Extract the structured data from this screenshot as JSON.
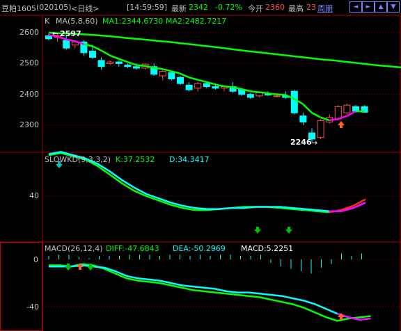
{
  "header": {
    "symbol": "豆粕1605",
    "code": "(020105)",
    "period": "<日线>",
    "time": "[14:59:59]",
    "last_label": "最新",
    "last_value": "2342",
    "change_pct": "-0.72%",
    "open_label": "今开",
    "open_value": "2360",
    "high_label": "最高",
    "high_value": "23",
    "cycle_label": "周期"
  },
  "nav_icons": [
    "arrow-left-icon",
    "arrow-right-icon",
    "arrow-up-icon",
    "arrow-down-icon"
  ],
  "colors": {
    "up": "#ff5050",
    "down": "#00ffff",
    "ma1": "#ffffff",
    "ma2": "#00ff00",
    "k": "#00ff00",
    "d": "#00ffff",
    "dea": "#ff00ff",
    "border": "#a00000"
  },
  "kline": {
    "title": "K",
    "ma_label": "MA(5,8,60)",
    "ma1_label": "MA1:2344.6730",
    "ma2_label": "MA2:2482.7217",
    "y_ticks": [
      "2600",
      "2500",
      "2400",
      "2300"
    ],
    "high_marker": "2597",
    "low_marker": "2246"
  },
  "kd": {
    "title": "SLOWKD(9,3,3,2)",
    "k_label": "K:37.2532",
    "d_label": "D:34.3417",
    "y_ticks": [
      "40"
    ]
  },
  "macd": {
    "title": "MACD(26,12,4)",
    "diff_label": "DIFF:-47.6843",
    "dea_label": "DEA:-50.2969",
    "macd_label": "MACD:5.2251",
    "y_ticks": [
      "0",
      "-40"
    ]
  },
  "chart_data": {
    "type": "candlestick",
    "candles": [
      {
        "o": 2590,
        "h": 2597,
        "l": 2575,
        "c": 2580
      },
      {
        "o": 2585,
        "h": 2596,
        "l": 2570,
        "c": 2592
      },
      {
        "o": 2575,
        "h": 2590,
        "l": 2545,
        "c": 2550
      },
      {
        "o": 2560,
        "h": 2575,
        "l": 2550,
        "c": 2570
      },
      {
        "o": 2570,
        "h": 2575,
        "l": 2525,
        "c": 2535
      },
      {
        "o": 2540,
        "h": 2560,
        "l": 2515,
        "c": 2520
      },
      {
        "o": 2510,
        "h": 2520,
        "l": 2480,
        "c": 2490
      },
      {
        "o": 2500,
        "h": 2510,
        "l": 2495,
        "c": 2505
      },
      {
        "o": 2505,
        "h": 2510,
        "l": 2490,
        "c": 2500
      },
      {
        "o": 2495,
        "h": 2500,
        "l": 2485,
        "c": 2490
      },
      {
        "o": 2490,
        "h": 2500,
        "l": 2480,
        "c": 2485
      },
      {
        "o": 2485,
        "h": 2500,
        "l": 2480,
        "c": 2498
      },
      {
        "o": 2490,
        "h": 2500,
        "l": 2460,
        "c": 2465
      },
      {
        "o": 2460,
        "h": 2480,
        "l": 2445,
        "c": 2475
      },
      {
        "o": 2470,
        "h": 2475,
        "l": 2445,
        "c": 2450
      },
      {
        "o": 2455,
        "h": 2460,
        "l": 2430,
        "c": 2435
      },
      {
        "o": 2430,
        "h": 2440,
        "l": 2410,
        "c": 2415
      },
      {
        "o": 2420,
        "h": 2440,
        "l": 2410,
        "c": 2435
      },
      {
        "o": 2435,
        "h": 2440,
        "l": 2420,
        "c": 2425
      },
      {
        "o": 2425,
        "h": 2435,
        "l": 2415,
        "c": 2420
      },
      {
        "o": 2420,
        "h": 2430,
        "l": 2410,
        "c": 2425
      },
      {
        "o": 2425,
        "h": 2440,
        "l": 2405,
        "c": 2410
      },
      {
        "o": 2415,
        "h": 2420,
        "l": 2395,
        "c": 2400
      },
      {
        "o": 2400,
        "h": 2405,
        "l": 2385,
        "c": 2390
      },
      {
        "o": 2395,
        "h": 2410,
        "l": 2390,
        "c": 2405
      },
      {
        "o": 2400,
        "h": 2410,
        "l": 2395,
        "c": 2398
      },
      {
        "o": 2395,
        "h": 2400,
        "l": 2390,
        "c": 2395
      },
      {
        "o": 2395,
        "h": 2410,
        "l": 2385,
        "c": 2390
      },
      {
        "o": 2410,
        "h": 2415,
        "l": 2335,
        "c": 2340
      },
      {
        "o": 2330,
        "h": 2340,
        "l": 2300,
        "c": 2310
      },
      {
        "o": 2275,
        "h": 2290,
        "l": 2246,
        "c": 2255
      },
      {
        "o": 2260,
        "h": 2320,
        "l": 2255,
        "c": 2315
      },
      {
        "o": 2310,
        "h": 2335,
        "l": 2305,
        "c": 2325
      },
      {
        "o": 2320,
        "h": 2365,
        "l": 2315,
        "c": 2360
      },
      {
        "o": 2340,
        "h": 2370,
        "l": 2335,
        "c": 2365
      },
      {
        "o": 2360,
        "h": 2365,
        "l": 2340,
        "c": 2345
      },
      {
        "o": 2360,
        "h": 2365,
        "l": 2340,
        "c": 2342
      }
    ],
    "ma1": [
      2592,
      2588,
      2578,
      2572,
      2563,
      2556,
      2542,
      2526,
      2515,
      2505,
      2495,
      2492,
      2486,
      2482,
      2475,
      2467,
      2455,
      2447,
      2440,
      2432,
      2426,
      2423,
      2417,
      2410,
      2407,
      2403,
      2400,
      2398,
      2385,
      2368,
      2340,
      2325,
      2316,
      2320,
      2330,
      2345,
      2345
    ],
    "ma2": [
      2600,
      2598,
      2597,
      2595,
      2593,
      2590,
      2587,
      2583,
      2580,
      2577,
      2573,
      2570,
      2566,
      2562,
      2558,
      2554,
      2550,
      2545,
      2541,
      2537,
      2533,
      2529,
      2525,
      2521,
      2517,
      2513,
      2510,
      2506,
      2502,
      2498,
      2494,
      2491,
      2488,
      2486,
      2484,
      2483,
      2482
    ],
    "kd_k": [
      78,
      80,
      77,
      74,
      68,
      60,
      52,
      45,
      40,
      36,
      32,
      29,
      27,
      27,
      28,
      29,
      30,
      30,
      30,
      29,
      28,
      27,
      26,
      25,
      27,
      31,
      37
    ],
    "kd_d": [
      79,
      81,
      78,
      75,
      70,
      63,
      55,
      48,
      42,
      38,
      34,
      31,
      29,
      28,
      28,
      29,
      29,
      30,
      30,
      30,
      29,
      28,
      27,
      26,
      26,
      29,
      34
    ],
    "macd_hist": [
      3,
      4,
      4,
      2,
      1,
      3,
      3,
      3,
      4,
      4,
      4,
      3,
      4,
      4,
      3,
      4,
      3,
      4,
      4,
      3,
      3,
      4,
      -3,
      -6,
      -8,
      -10,
      -12,
      -7,
      -4,
      5,
      3,
      5
    ],
    "diff": [
      -5,
      -5,
      -6,
      -4,
      -5,
      -8,
      -12,
      -16,
      -18,
      -19,
      -20,
      -22,
      -24,
      -26,
      -27,
      -28,
      -29,
      -30,
      -31,
      -32,
      -34,
      -36,
      -38,
      -41,
      -45,
      -49,
      -52,
      -50,
      -49,
      -48
    ],
    "dea": [
      -6,
      -6,
      -6,
      -5,
      -6,
      -7,
      -10,
      -14,
      -16,
      -17,
      -18,
      -20,
      -22,
      -23,
      -24,
      -25,
      -27,
      -28,
      -28,
      -29,
      -30,
      -31,
      -33,
      -35,
      -38,
      -42,
      -46,
      -49,
      -51,
      -50
    ]
  }
}
